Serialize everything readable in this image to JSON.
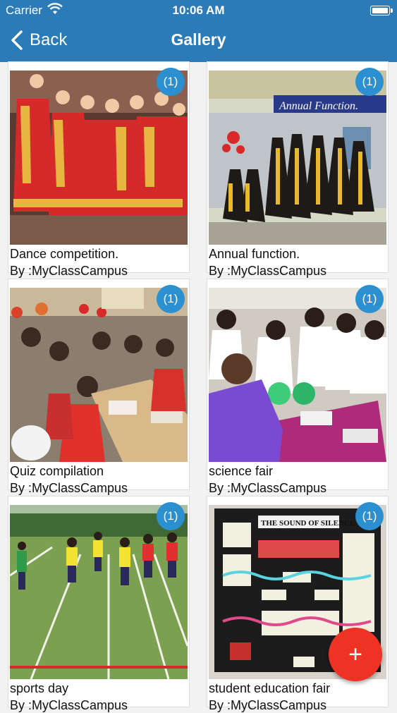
{
  "status_bar": {
    "carrier": "Carrier",
    "time": "10:06 AM"
  },
  "nav": {
    "back_label": "Back",
    "title": "Gallery"
  },
  "items": [
    {
      "title": "Dance competition.",
      "author": "By :MyClassCampus",
      "count": "(1)"
    },
    {
      "title": "Annual function.",
      "author": "By :MyClassCampus",
      "count": "(1)"
    },
    {
      "title": "Quiz compilation",
      "author": "By :MyClassCampus",
      "count": "(1)"
    },
    {
      "title": "science fair",
      "author": "By :MyClassCampus",
      "count": "(1)"
    },
    {
      "title": "sports day",
      "author": "By :MyClassCampus",
      "count": "(1)"
    },
    {
      "title": "student education fair",
      "author": "By :MyClassCampus",
      "count": "(1)"
    }
  ],
  "photo_texts": {
    "banner": "Annual Function.",
    "poster": "THE SOUND OF SILENCE"
  },
  "fab": {
    "label": "+"
  },
  "colors": {
    "nav_bar": "#2b7bb9",
    "badge": "#2b8fd0",
    "fab": "#ee3224"
  }
}
